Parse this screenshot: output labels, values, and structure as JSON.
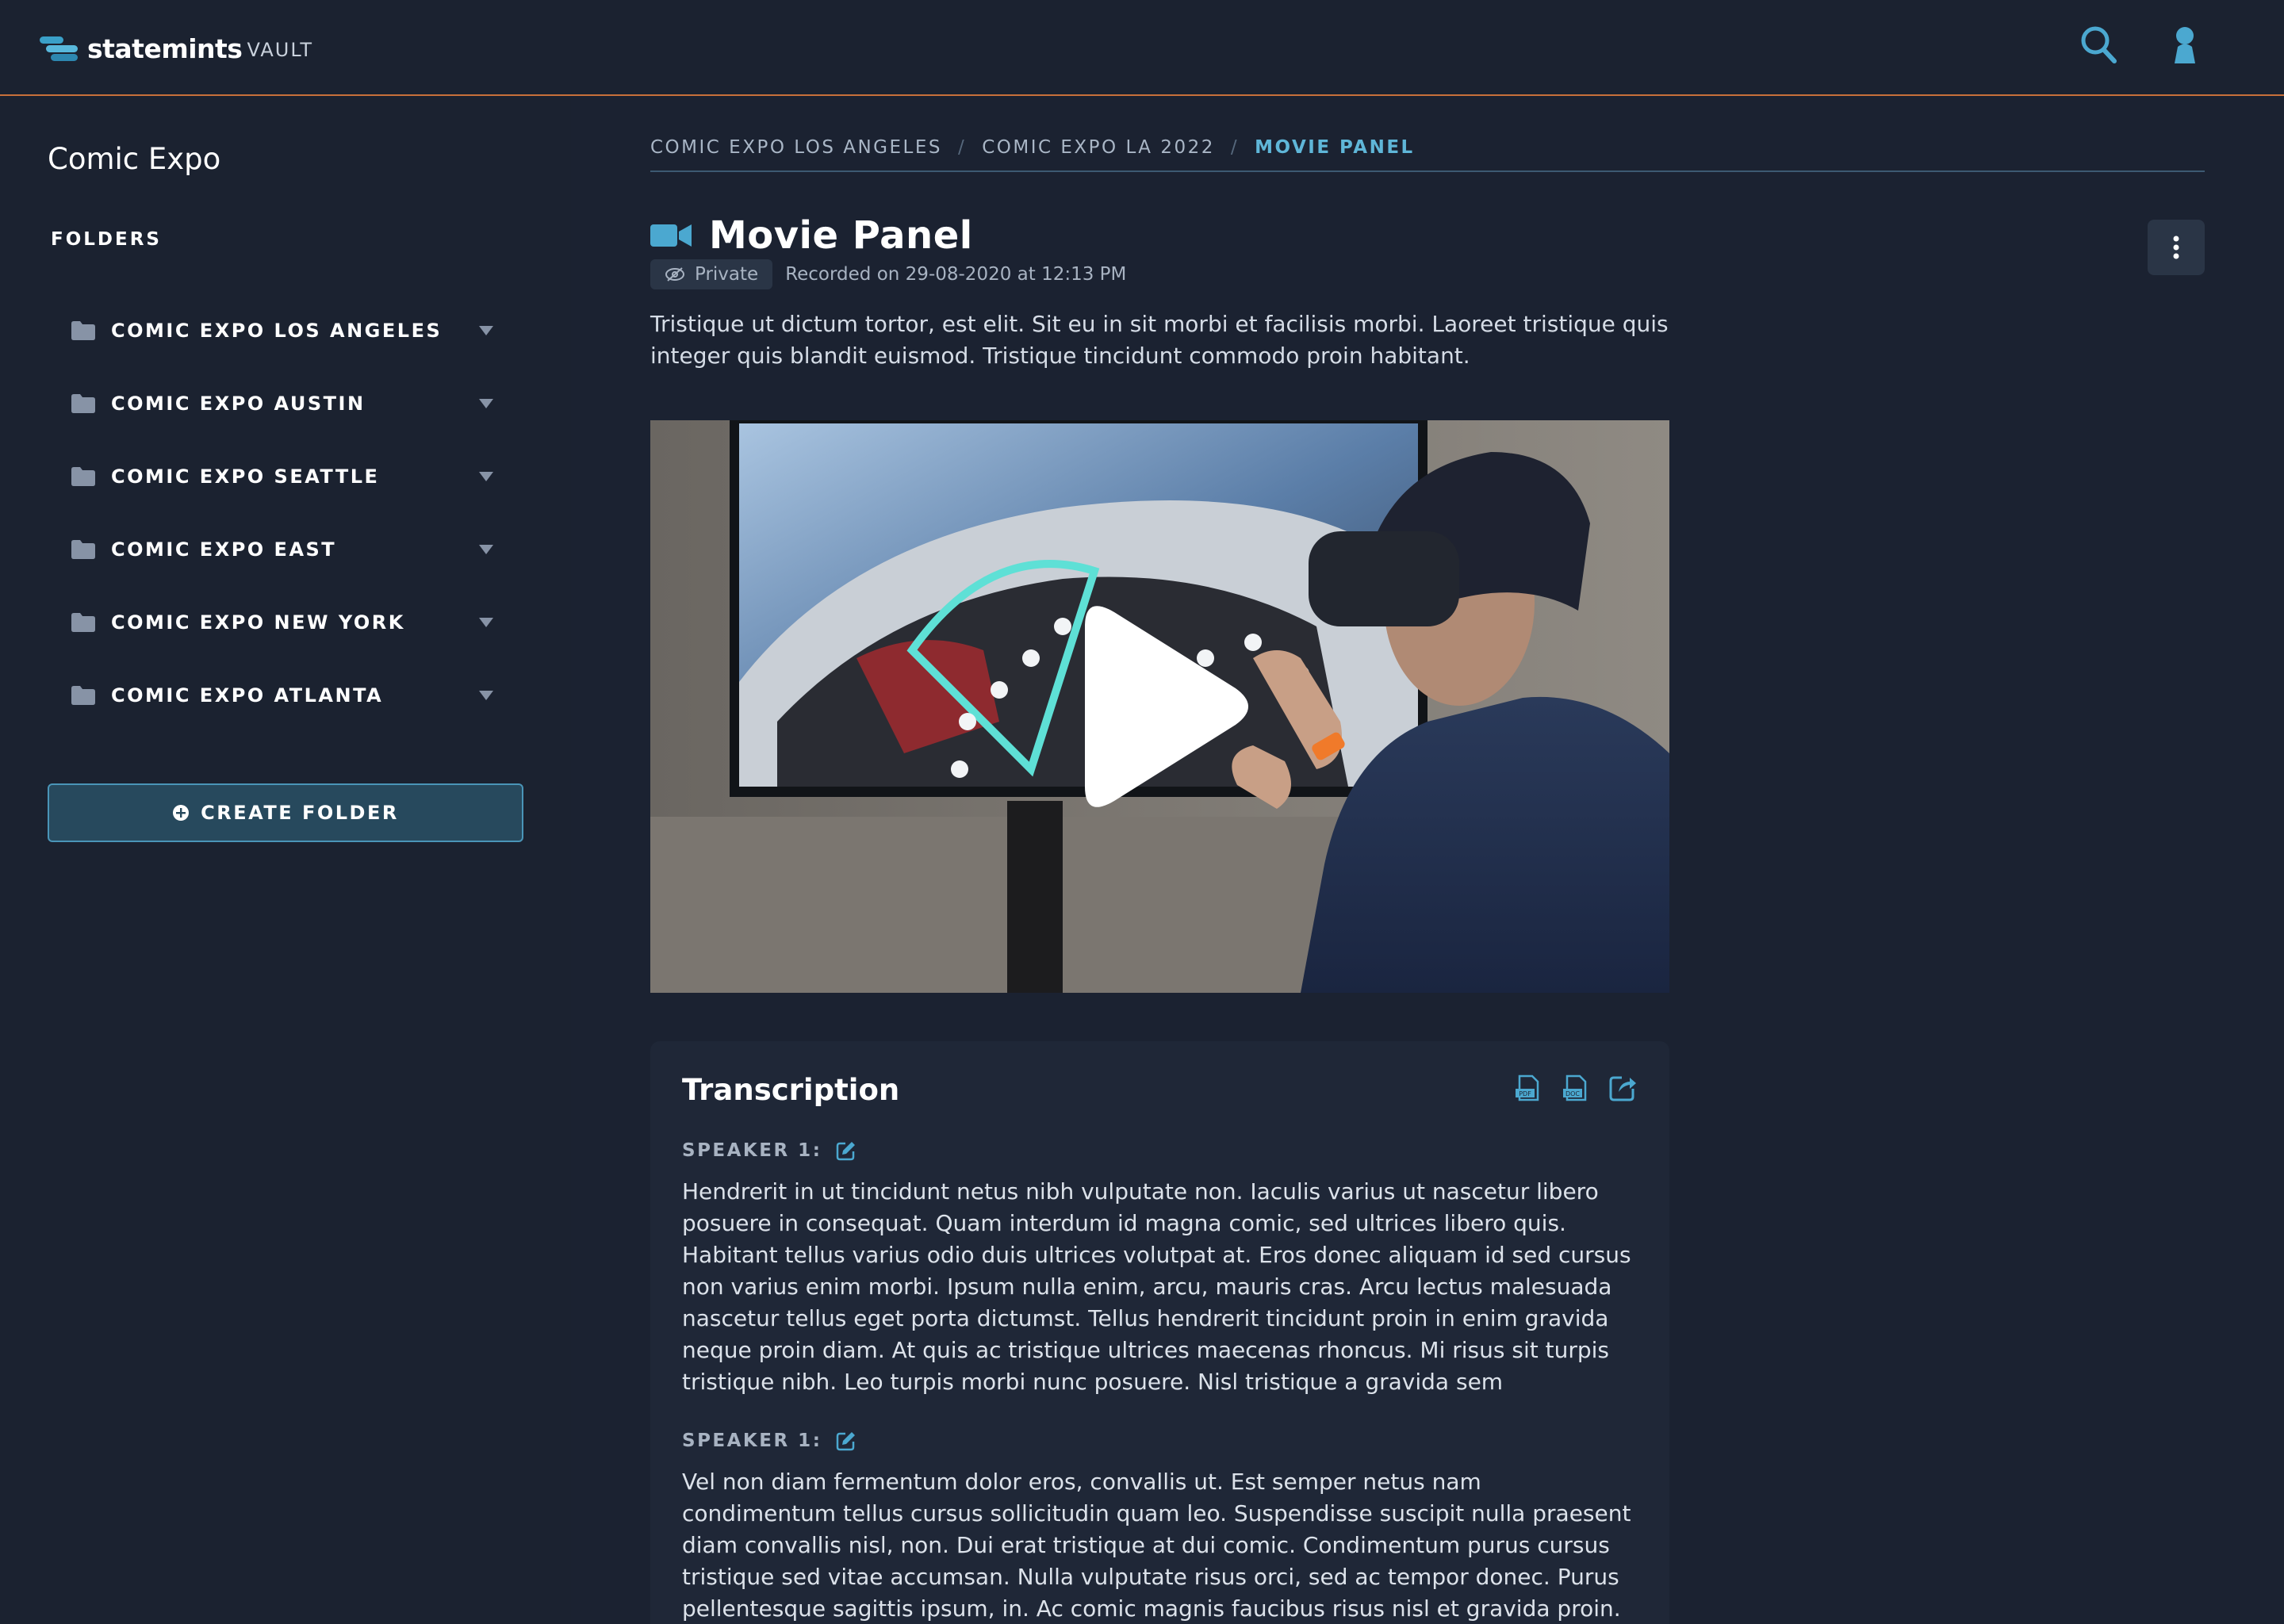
{
  "app": {
    "brand": "statemints",
    "brand_suffix": "VAULT"
  },
  "colors": {
    "accent": "#4ba8d0",
    "topbar_border": "#c8703a",
    "background": "#1b2230",
    "button_bg": "#27495d"
  },
  "topbar": {
    "search_icon": "search-icon",
    "user_icon": "user-icon"
  },
  "sidebar": {
    "title": "Comic Expo",
    "section_label": "FOLDERS",
    "folders": [
      {
        "label": "COMIC EXPO LOS ANGELES"
      },
      {
        "label": "COMIC EXPO AUSTIN"
      },
      {
        "label": "COMIC EXPO SEATTLE"
      },
      {
        "label": "COMIC EXPO EAST"
      },
      {
        "label": "COMIC EXPO NEW YORK"
      },
      {
        "label": "COMIC EXPO ATLANTA"
      }
    ],
    "create_button": "CREATE FOLDER"
  },
  "breadcrumb": [
    {
      "label": "COMIC EXPO LOS ANGELES"
    },
    {
      "label": "COMIC EXPO LA 2022"
    },
    {
      "label": "MOVIE PANEL"
    }
  ],
  "breadcrumb_separator": "/",
  "page": {
    "title": "Movie Panel",
    "visibility": "Private",
    "recorded": "Recorded on 29-08-2020 at 12:13 PM",
    "description": "Tristique ut dictum tortor, est elit. Sit eu in sit morbi et facilisis morbi. Laoreet tristique quis integer quis blandit euismod. Tristique tincidunt commodo proin habitant."
  },
  "transcription": {
    "title": "Transcription",
    "actions": [
      "pdf-download-icon",
      "doc-download-icon",
      "share-icon"
    ],
    "segments": [
      {
        "speaker": "SPEAKER 1:",
        "text": "Hendrerit in ut tincidunt netus nibh vulputate non. Iaculis varius ut nascetur libero posuere in consequat. Quam interdum id magna comic, sed ultrices libero quis. Habitant tellus varius odio duis ultrices volutpat at. Eros donec aliquam id sed cursus non varius enim morbi. Ipsum nulla enim, arcu, mauris cras. Arcu lectus malesuada nascetur tellus eget porta dictumst. Tellus hendrerit tincidunt proin in enim gravida neque proin diam. At quis ac tristique ultrices maecenas rhoncus. Mi risus sit turpis tristique nibh. Leo turpis morbi nunc posuere. Nisl tristique a gravida sem"
      },
      {
        "speaker": "SPEAKER 1:",
        "text": "Vel non diam fermentum dolor eros, convallis ut. Est semper netus nam condimentum tellus cursus sollicitudin quam leo. Suspendisse suscipit nulla praesent diam convallis nisl, non. Dui erat tristique at dui comic. Condimentum purus cursus tristique sed vitae accumsan. Nulla vulputate risus orci, sed ac tempor donec. Purus pellentesque sagittis ipsum, in. Ac comic magnis faucibus risus nisl et gravida proin. Arcu quam nunc,"
      }
    ]
  }
}
